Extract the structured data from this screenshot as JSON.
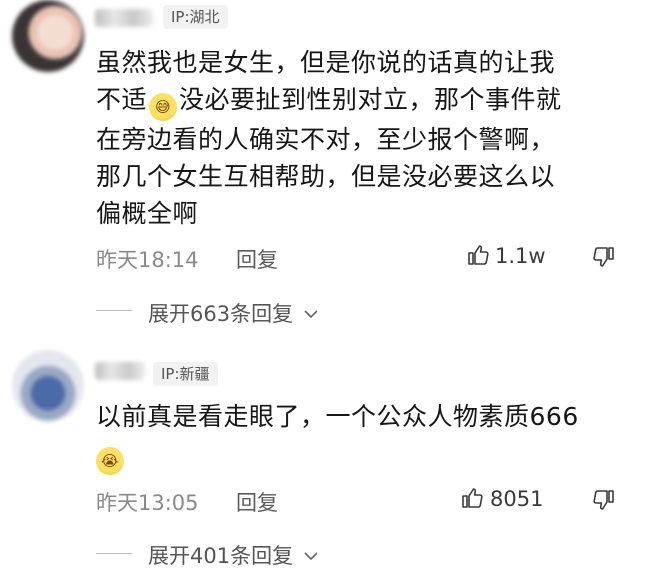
{
  "comments": [
    {
      "ip": "IP:湖北",
      "lines": [
        "虽然我也是女生，但是你说的话真的让我",
        "不适",
        "没必要扯到性别对立，那个事件就",
        "在旁边看的人确实不对，至少报个警啊，",
        "那几个女生互相帮助，但是没必要这么以",
        "偏概全啊"
      ],
      "emoji": "sweat-smile-emoji",
      "time": "昨天18:14",
      "reply_label": "回复",
      "likes": "1.1w",
      "expand_label": "展开663条回复"
    },
    {
      "ip": "IP:新疆",
      "lines": [
        "以前真是看走眼了，一个公众人物素质666"
      ],
      "emoji": "crying-emoji",
      "time": "昨天13:05",
      "reply_label": "回复",
      "likes": "8051",
      "expand_label": "展开401条回复"
    }
  ],
  "icons": {
    "like": "thumbs-up-icon",
    "dislike": "thumbs-down-icon",
    "expand": "chevron-down-icon"
  }
}
